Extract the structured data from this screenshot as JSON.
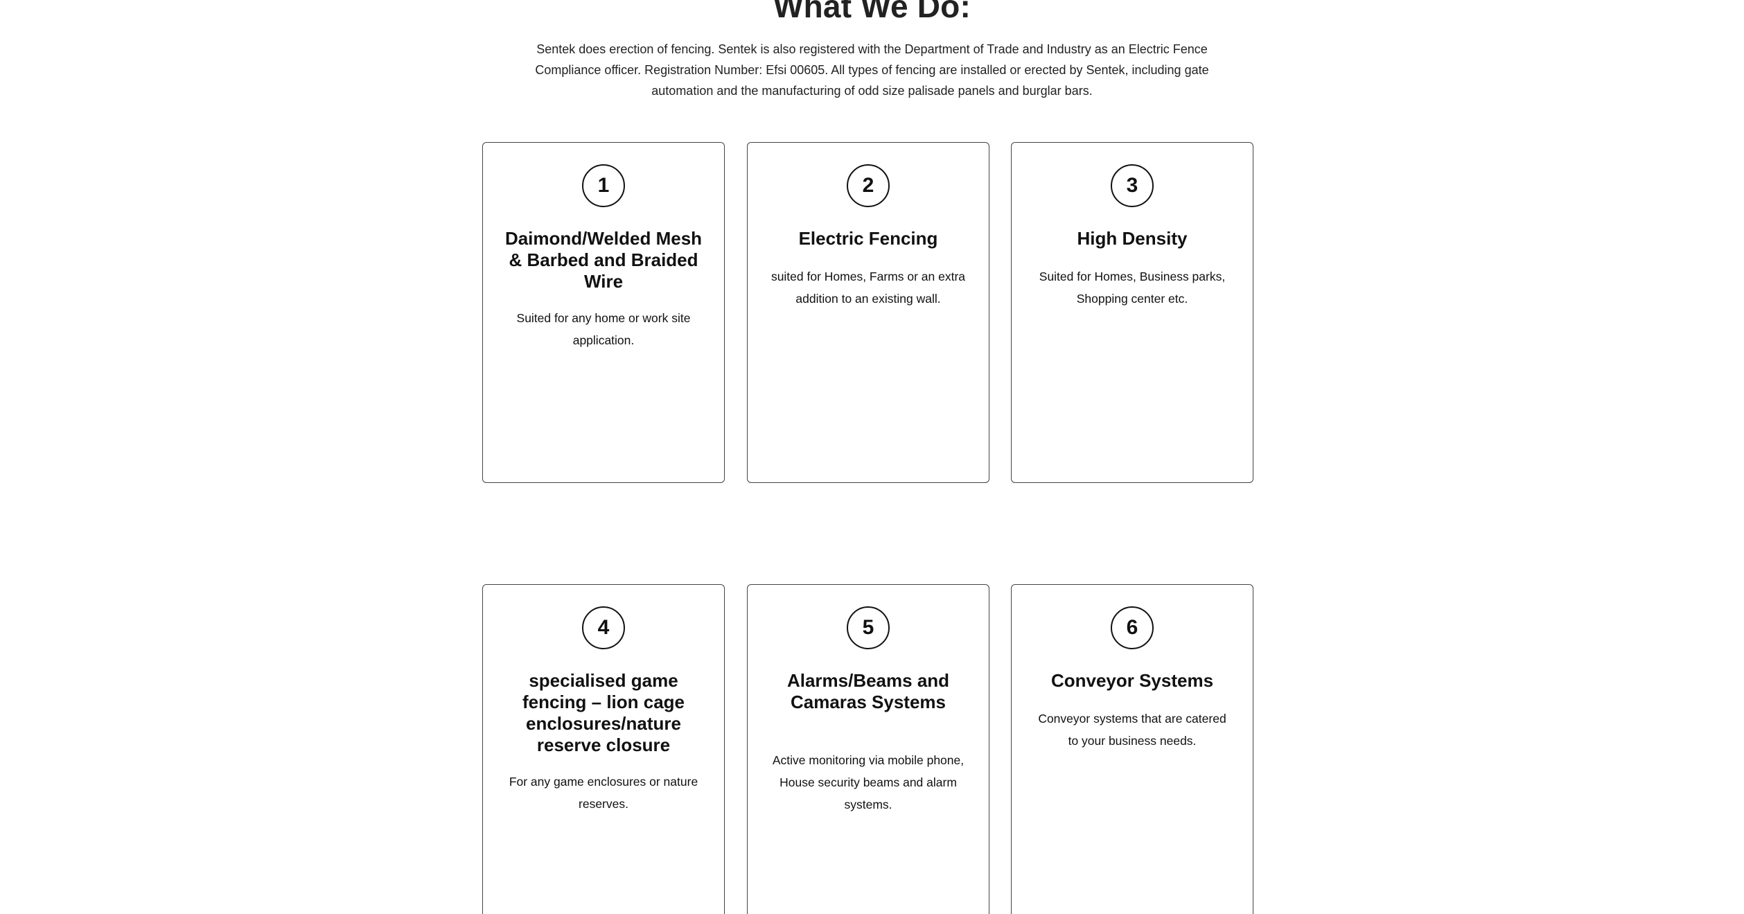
{
  "section": {
    "heading": "What We Do:",
    "intro": "Sentek does erection of fencing. Sentek is also registered with the Department of Trade and Industry as an Electric Fence Compliance officer. Registration Number: Efsi 00605. All types of fencing are installed or erected by Sentek, including gate automation and the manufacturing of odd size palisade panels and burglar bars."
  },
  "cards": [
    {
      "number": "1",
      "title": "Daimond/Welded Mesh & Barbed and Braided Wire",
      "description": "Suited for any home or work site application."
    },
    {
      "number": "2",
      "title": "Electric Fencing",
      "description": "suited for Homes, Farms or an extra addition to an existing wall."
    },
    {
      "number": "3",
      "title": "High Density",
      "description": "Suited for Homes, Business parks, Shopping center etc."
    },
    {
      "number": "4",
      "title": "specialised game fencing – lion cage enclosures/nature reserve closure",
      "description": "For any game enclosures or nature reserves."
    },
    {
      "number": "5",
      "title": "Alarms/Beams and Camaras Systems",
      "description": "Active monitoring via mobile phone, House security beams and alarm systems."
    },
    {
      "number": "6",
      "title": "Conveyor Systems",
      "description": "Conveyor systems that are catered to your business needs."
    }
  ]
}
